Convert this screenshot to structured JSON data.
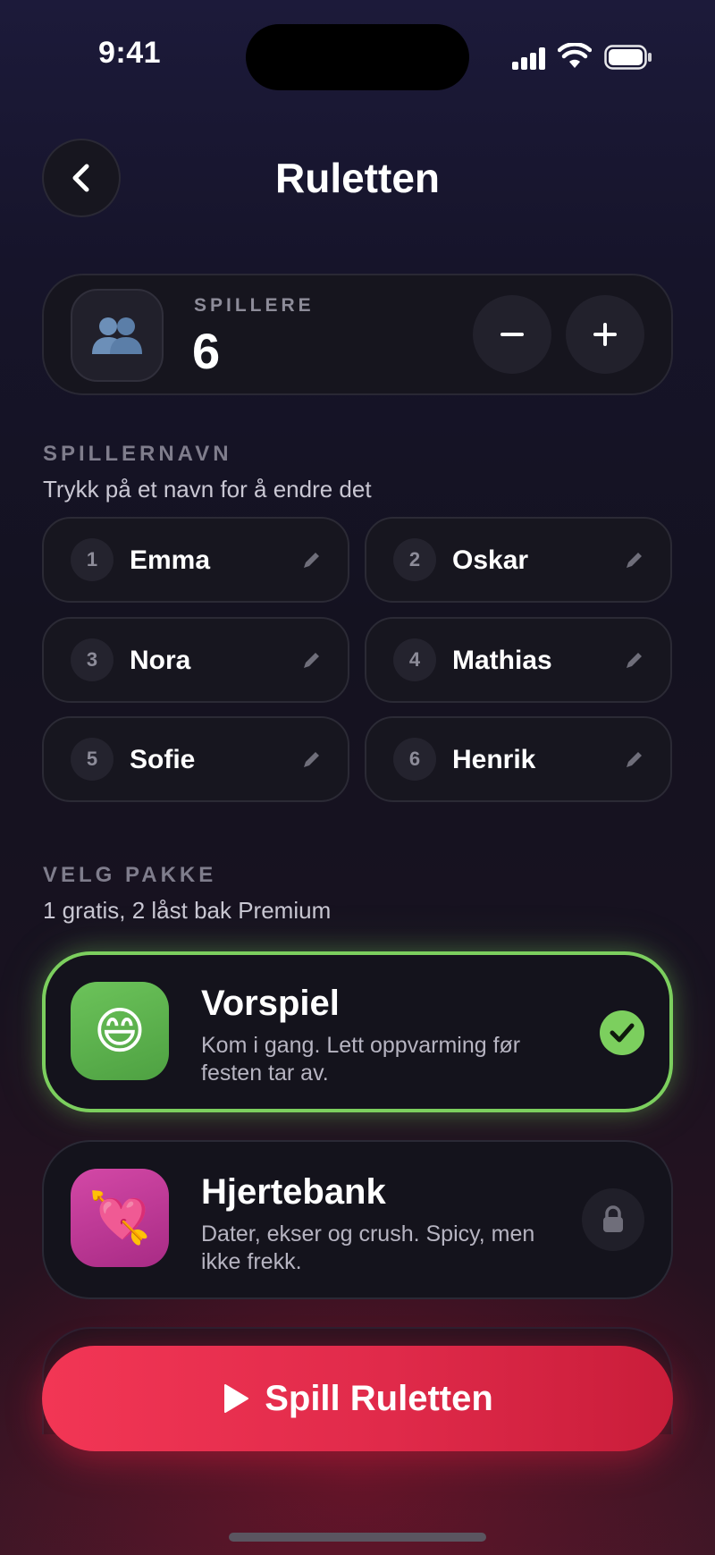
{
  "status_bar": {
    "time": "9:41"
  },
  "header": {
    "title": "Ruletten",
    "back_icon": "chevron-left-icon"
  },
  "players": {
    "label": "SPILLERE",
    "count": "6",
    "icon": "people-icon",
    "minus_label": "−",
    "plus_label": "+"
  },
  "names_section": {
    "label": "SPILLERNAVN",
    "subtitle": "Trykk på et navn for å endre det",
    "players": [
      {
        "num": "1",
        "name": "Emma"
      },
      {
        "num": "2",
        "name": "Oskar"
      },
      {
        "num": "3",
        "name": "Nora"
      },
      {
        "num": "4",
        "name": "Mathias"
      },
      {
        "num": "5",
        "name": "Sofie"
      },
      {
        "num": "6",
        "name": "Henrik"
      }
    ]
  },
  "packs_section": {
    "label": "VELG PAKKE",
    "subtitle": "1 gratis, 2 låst bak Premium",
    "packs": [
      {
        "emoji": "😄",
        "title": "Vorspiel",
        "description": "Kom i gang. Lett oppvarming før festen tar av.",
        "state": "selected",
        "color": "#5fb84f"
      },
      {
        "emoji": "💘",
        "title": "Hjertebank",
        "description": "Dater, ekser og crush. Spicy, men ikke frekk.",
        "state": "locked",
        "color": "#c8389b"
      }
    ]
  },
  "play_button": {
    "label": "Spill Ruletten",
    "icon": "play-icon"
  },
  "colors": {
    "accent_green": "#7ccf5e",
    "accent_red": "#e02a4a"
  }
}
